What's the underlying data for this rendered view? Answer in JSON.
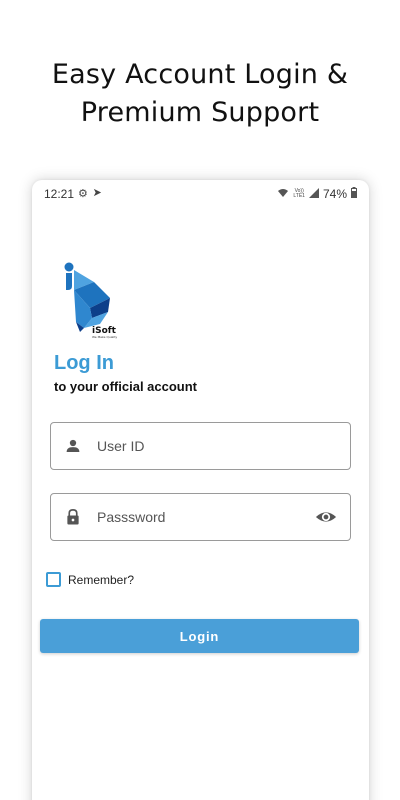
{
  "headline": {
    "line1": "Easy Account Login &",
    "line2": "Premium Support"
  },
  "status_bar": {
    "time": "12:21",
    "network_top": "Vo))",
    "network_bottom": "LTE1",
    "battery": "74%"
  },
  "logo": {
    "brand": "iSoft",
    "tagline": "We Make Quality",
    "colors": {
      "primary": "#1e73be",
      "light": "#4fa3e0",
      "dark": "#0d3f8a"
    }
  },
  "login": {
    "title": "Log In",
    "subtitle": "to your official account",
    "user_id_placeholder": "User ID",
    "password_placeholder": "Passsword",
    "remember_label": "Remember?",
    "login_button": "Login"
  },
  "icons": {
    "user_field": "person-icon",
    "password_field": "lock-icon",
    "password_toggle": "eye-icon"
  },
  "colors": {
    "accent": "#3c9bd5",
    "button": "#4a9fd8"
  }
}
